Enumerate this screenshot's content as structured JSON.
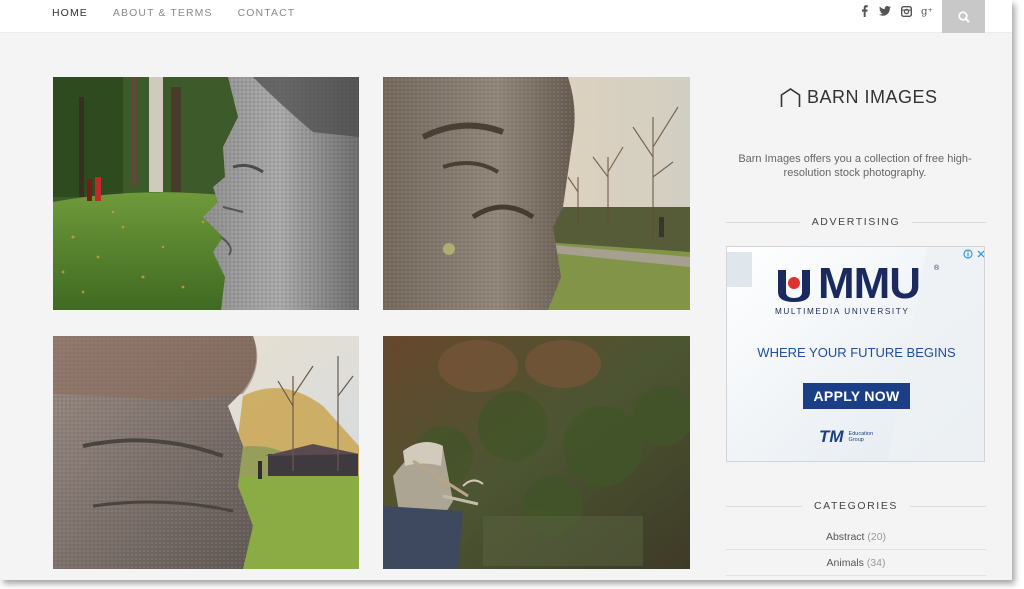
{
  "nav": {
    "items": [
      {
        "label": "HOME",
        "active": true
      },
      {
        "label": "ABOUT & TERMS",
        "active": false
      },
      {
        "label": "CONTACT",
        "active": false
      }
    ],
    "social_icons": [
      "facebook-icon",
      "twitter-icon",
      "instagram-icon",
      "google-plus-icon"
    ],
    "search_icon": "search-icon"
  },
  "sidebar": {
    "logo_icon": "house-outline-icon",
    "logo_text": "BARN IMAGES",
    "tagline": "Barn Images offers you a collection of free high-resolution stock photography.",
    "advertising_title": "ADVERTISING",
    "ad": {
      "brand": "MMU",
      "registered": "®",
      "subtitle": "MULTIMEDIA UNIVERSITY",
      "slogan": "WHERE YOUR FUTURE BEGINS",
      "cta": "APPLY NOW",
      "partner_logo": "TM",
      "partner_sub_1": "Education",
      "partner_sub_2": "Group",
      "colors": {
        "navy": "#1b2a5e",
        "blue": "#1f4fa0",
        "button": "#1b3f87",
        "red": "#e0312f"
      }
    },
    "categories_title": "CATEGORIES",
    "categories": [
      {
        "name": "Abstract",
        "count": "(20)"
      },
      {
        "name": "Animals",
        "count": "(34)"
      }
    ]
  },
  "photos": [
    {
      "subject": "stone-head-sculpture-profile"
    },
    {
      "subject": "stone-head-sculpture-park"
    },
    {
      "subject": "stone-sculpture-closeup"
    },
    {
      "subject": "man-with-pipe-double-exposure"
    }
  ],
  "colors": {
    "background": "#f4f4f4",
    "search_bg": "#c8c8c8",
    "text_dark": "#333333"
  }
}
